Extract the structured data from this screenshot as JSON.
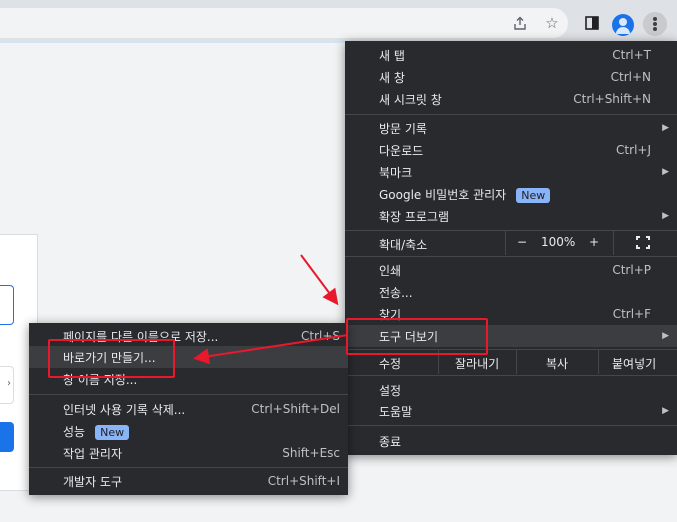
{
  "main_menu": {
    "new_tab": {
      "label": "새 탭",
      "shortcut": "Ctrl+T"
    },
    "new_window": {
      "label": "새 창",
      "shortcut": "Ctrl+N"
    },
    "incognito": {
      "label": "새 시크릿 창",
      "shortcut": "Ctrl+Shift+N"
    },
    "history": {
      "label": "방문 기록"
    },
    "downloads": {
      "label": "다운로드",
      "shortcut": "Ctrl+J"
    },
    "bookmarks": {
      "label": "북마크"
    },
    "passwords": {
      "label": "Google 비밀번호 관리자",
      "badge": "New"
    },
    "extensions": {
      "label": "확장 프로그램"
    },
    "zoom": {
      "label": "확대/축소",
      "minus": "−",
      "value": "100%",
      "plus": "+"
    },
    "print": {
      "label": "인쇄",
      "shortcut": "Ctrl+P"
    },
    "cast": {
      "label": "전송..."
    },
    "find": {
      "label": "찾기",
      "shortcut": "Ctrl+F"
    },
    "more_tools": {
      "label": "도구 더보기"
    },
    "edit": {
      "label": "수정",
      "cut": "잘라내기",
      "copy": "복사",
      "paste": "붙여넣기"
    },
    "settings": {
      "label": "설정"
    },
    "help": {
      "label": "도움말"
    },
    "exit": {
      "label": "종료"
    }
  },
  "sub_menu": {
    "save_page": {
      "label": "페이지를 다른 이름으로 저장...",
      "shortcut": "Ctrl+S"
    },
    "create_shortcut": {
      "label": "바로가기 만들기..."
    },
    "name_window": {
      "label": "창 이름 지정..."
    },
    "clear_data": {
      "label": "인터넷 사용 기록 삭제...",
      "shortcut": "Ctrl+Shift+Del"
    },
    "performance": {
      "label": "성능",
      "badge": "New"
    },
    "task_manager": {
      "label": "작업 관리자",
      "shortcut": "Shift+Esc"
    },
    "dev_tools": {
      "label": "개발자 도구",
      "shortcut": "Ctrl+Shift+I"
    }
  },
  "toolbar": {
    "icons": [
      "share-icon",
      "star-icon",
      "side-panel-icon",
      "profile-icon",
      "kebab-menu-icon"
    ]
  },
  "colors": {
    "menu_bg": "#292a2d",
    "menu_highlight": "#3c3d41",
    "annotation_red": "#e8192c",
    "badge_blue": "#8ab4f8"
  }
}
